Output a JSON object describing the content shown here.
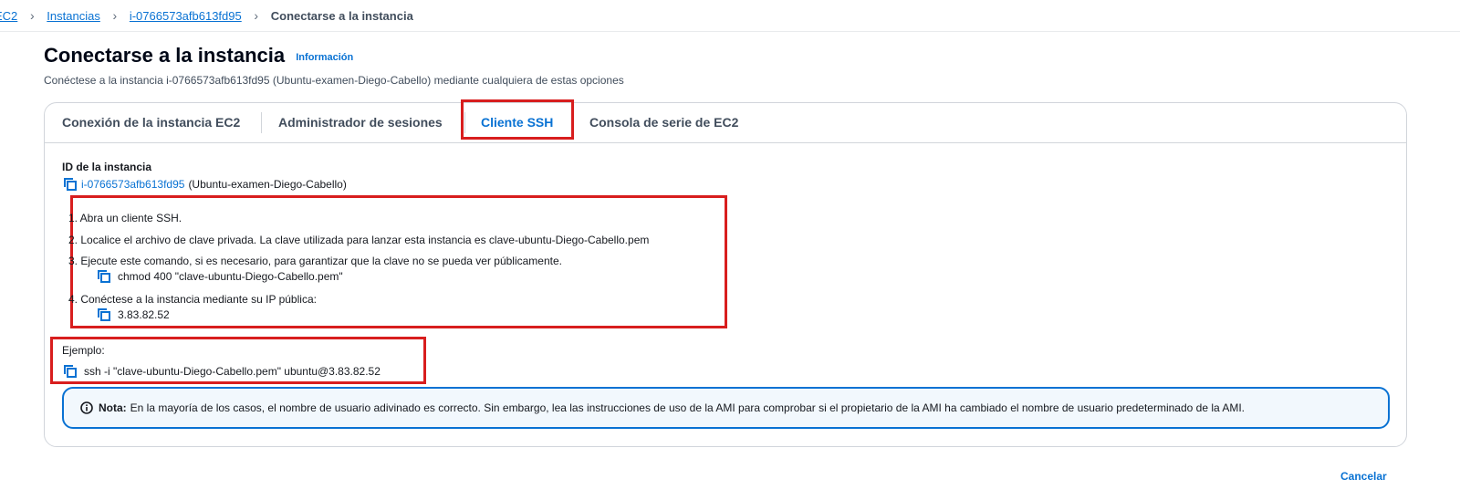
{
  "breadcrumb": {
    "items": [
      {
        "label": "EC2"
      },
      {
        "label": "Instancias"
      },
      {
        "label": "i-0766573afb613fd95"
      }
    ],
    "current": "Conectarse a la instancia"
  },
  "header": {
    "title": "Conectarse a la instancia",
    "info_link": "Información",
    "description": "Conéctese a la instancia i-0766573afb613fd95 (Ubuntu-examen-Diego-Cabello) mediante cualquiera de estas opciones"
  },
  "tabs": [
    {
      "label": "Conexión de la instancia EC2",
      "active": false
    },
    {
      "label": "Administrador de sesiones",
      "active": false
    },
    {
      "label": "Cliente SSH",
      "active": true
    },
    {
      "label": "Consola de serie de EC2",
      "active": false
    }
  ],
  "instance": {
    "label": "ID de la instancia",
    "id": "i-0766573afb613fd95",
    "name": "(Ubuntu-examen-Diego-Cabello)"
  },
  "steps": {
    "step1": "1. Abra un cliente SSH.",
    "step2": "2. Localice el archivo de clave privada. La clave utilizada para lanzar esta instancia es clave-ubuntu-Diego-Cabello.pem",
    "step3": "3. Ejecute este comando, si es necesario, para garantizar que la clave no se pueda ver públicamente.",
    "step3_cmd": "chmod 400 \"clave-ubuntu-Diego-Cabello.pem\"",
    "step4": "4. Conéctese a la instancia mediante su IP pública:",
    "step4_ip": "3.83.82.52"
  },
  "example": {
    "label": "Ejemplo:",
    "command": "ssh -i \"clave-ubuntu-Diego-Cabello.pem\" ubuntu@3.83.82.52"
  },
  "note": {
    "bold": "Nota:",
    "text": "En la mayoría de los casos, el nombre de usuario adivinado es correcto. Sin embargo, lea las instrucciones de uso de la AMI para comprobar si el propietario de la AMI ha cambiado el nombre de usuario predeterminado de la AMI."
  },
  "footer": {
    "cancel_label": "Cancelar"
  },
  "colors": {
    "link": "#0972d3",
    "highlight": "#d81e1e",
    "note_border": "#0972d3"
  }
}
